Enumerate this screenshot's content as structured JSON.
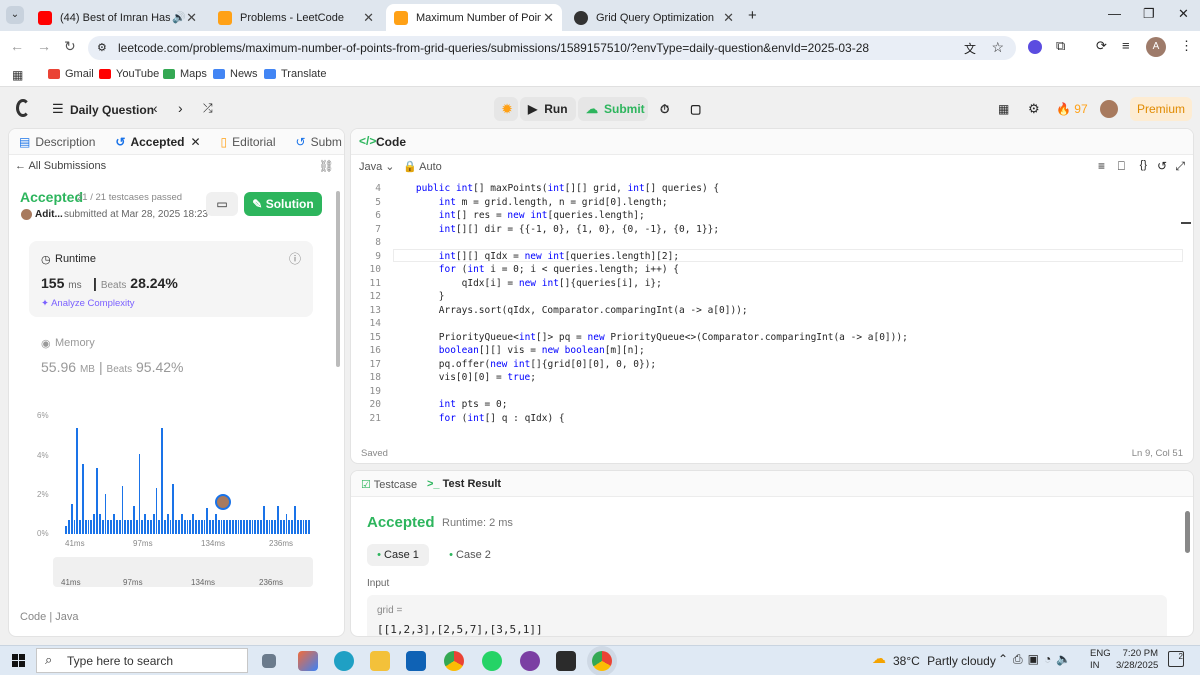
{
  "browser": {
    "tabs": [
      {
        "label": "(44) Best of Imran Hashmi s"
      },
      {
        "label": "Problems - LeetCode"
      },
      {
        "label": "Maximum Number of Points Fr"
      },
      {
        "label": "Grid Query Optimization"
      }
    ],
    "url": "leetcode.com/problems/maximum-number-of-points-from-grid-queries/submissions/1589157510/?envType=daily-question&envId=2025-03-28",
    "profile_initial": "A"
  },
  "bookmarks": [
    {
      "label": "Gmail"
    },
    {
      "label": "YouTube"
    },
    {
      "label": "Maps"
    },
    {
      "label": "News"
    },
    {
      "label": "Translate"
    }
  ],
  "header": {
    "daily": "Daily Question",
    "run": "Run",
    "submit": "Submit",
    "streak": "97",
    "premium": "Premium"
  },
  "left": {
    "tabs": [
      "Description",
      "Accepted",
      "Editorial",
      "Subm"
    ],
    "all_subs": "All Submissions",
    "status": "Accepted",
    "passed": "21 / 21 testcases passed",
    "user": "Adit...",
    "submitted": "submitted at Mar 28, 2025 18:23",
    "solution": "Solution",
    "runtime": {
      "label": "Runtime",
      "value": "155",
      "unit": "ms",
      "beats_label": "Beats",
      "beats": "28.24%",
      "analyze": "Analyze Complexity"
    },
    "memory": {
      "label": "Memory",
      "value": "55.96",
      "unit": "MB",
      "beats_label": "Beats",
      "beats": "95.42%"
    },
    "footer_code": "Code",
    "footer_lang": "Java"
  },
  "chart_data": {
    "type": "bar",
    "yticks": [
      "6%",
      "4%",
      "2%",
      "0%"
    ],
    "xticks": [
      "41ms",
      "97ms",
      "134ms",
      "236ms"
    ],
    "values": [
      0.4,
      0.7,
      1.5,
      0.7,
      5.3,
      0.7,
      3.5,
      0.7,
      0.7,
      0.7,
      1.0,
      3.3,
      1.0,
      0.7,
      2.0,
      0.7,
      0.7,
      1.0,
      0.7,
      0.7,
      2.4,
      0.7,
      0.7,
      0.7,
      1.4,
      0.7,
      4.0,
      0.7,
      1.0,
      0.7,
      0.7,
      1.0,
      2.3,
      0.7,
      5.3,
      0.7,
      1.0,
      0.7,
      2.5,
      0.7,
      0.7,
      1.0,
      0.7,
      0.7,
      0.7,
      1.0,
      0.7,
      0.7,
      0.7,
      0.7,
      1.3,
      0.7,
      0.7,
      1.0,
      0.7,
      0.7,
      0.7,
      0.7,
      0.7,
      0.7,
      0.7,
      0.7,
      0.7,
      0.7,
      0.7,
      0.7,
      0.7,
      0.7,
      0.7,
      0.7,
      1.4,
      0.7,
      0.7,
      0.7,
      0.7,
      1.4,
      0.7,
      0.7,
      1.0,
      0.7,
      0.7,
      1.4,
      0.7,
      0.7,
      0.7,
      0.7,
      0.7
    ],
    "ylim": [
      0,
      6
    ]
  },
  "editor": {
    "title": "Code",
    "lang": "Java",
    "mode": "Auto",
    "saved": "Saved",
    "position": "Ln 9, Col 51",
    "lines": [
      {
        "n": "4",
        "t": "    public int[] maxPoints(int[][] grid, int[] queries) {"
      },
      {
        "n": "5",
        "t": "        int m = grid.length, n = grid[0].length;"
      },
      {
        "n": "6",
        "t": "        int[] res = new int[queries.length];"
      },
      {
        "n": "7",
        "t": "        int[][] dir = {{-1, 0}, {1, 0}, {0, -1}, {0, 1}};"
      },
      {
        "n": "8",
        "t": ""
      },
      {
        "n": "9",
        "t": "        int[][] qIdx = new int[queries.length][2];"
      },
      {
        "n": "10",
        "t": "        for (int i = 0; i < queries.length; i++) {"
      },
      {
        "n": "11",
        "t": "            qIdx[i] = new int[]{queries[i], i};"
      },
      {
        "n": "12",
        "t": "        }"
      },
      {
        "n": "13",
        "t": "        Arrays.sort(qIdx, Comparator.comparingInt(a -> a[0]));"
      },
      {
        "n": "14",
        "t": ""
      },
      {
        "n": "15",
        "t": "        PriorityQueue<int[]> pq = new PriorityQueue<>(Comparator.comparingInt(a -> a[0]));"
      },
      {
        "n": "16",
        "t": "        boolean[][] vis = new boolean[m][n];"
      },
      {
        "n": "17",
        "t": "        pq.offer(new int[]{grid[0][0], 0, 0});"
      },
      {
        "n": "18",
        "t": "        vis[0][0] = true;"
      },
      {
        "n": "19",
        "t": ""
      },
      {
        "n": "20",
        "t": "        int pts = 0;"
      },
      {
        "n": "21",
        "t": "        for (int[] q : qIdx) {"
      }
    ]
  },
  "result": {
    "tab1": "Testcase",
    "tab2": "Test Result",
    "status": "Accepted",
    "runtime": "Runtime: 2 ms",
    "case1": "Case 1",
    "case2": "Case 2",
    "input_label": "Input",
    "var": "grid =",
    "value": "[[1,2,3],[2,5,7],[3,5,1]]"
  },
  "taskbar": {
    "search": "Type here to search",
    "temp": "38°C",
    "weather": "Partly cloudy",
    "lang1": "ENG",
    "lang2": "IN",
    "time": "7:20 PM",
    "date": "3/28/2025",
    "notif": "2"
  }
}
